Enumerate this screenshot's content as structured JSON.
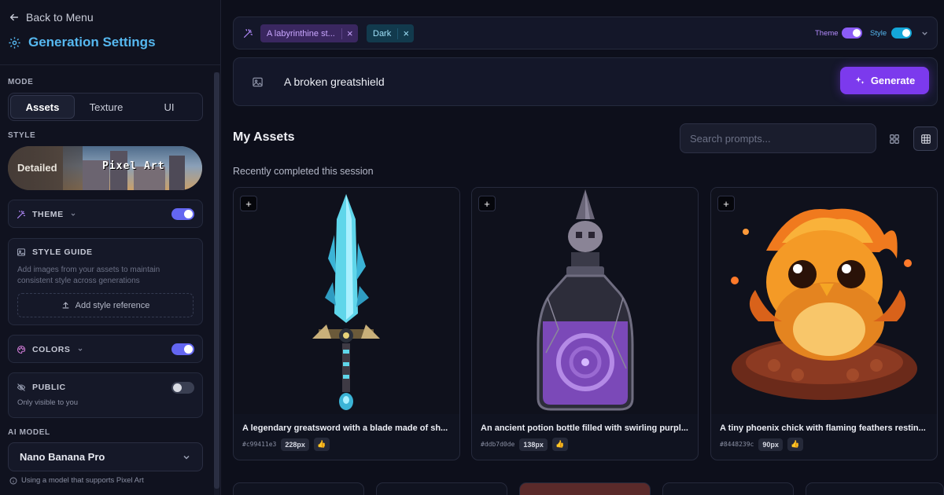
{
  "sidebar": {
    "back_label": "Back to Menu",
    "title": "Generation Settings",
    "mode": {
      "label": "MODE",
      "options": [
        "Assets",
        "Texture",
        "UI"
      ],
      "selected": "Assets"
    },
    "style": {
      "label": "STYLE",
      "left_option": "Detailed",
      "right_option": "Pixel Art"
    },
    "theme": {
      "label": "THEME",
      "enabled": true
    },
    "style_guide": {
      "label": "STYLE GUIDE",
      "description": "Add images from your assets to maintain consistent style across generations",
      "add_button": "Add style reference"
    },
    "colors": {
      "label": "COLORS",
      "enabled": true
    },
    "public": {
      "label": "PUBLIC",
      "enabled": false,
      "subtitle": "Only visible to you"
    },
    "ai_model": {
      "label": "AI MODEL",
      "selected": "Nano Banana Pro",
      "note": "Using a model that supports Pixel Art"
    }
  },
  "topbar": {
    "chips": [
      {
        "label": "A labyrinthine st...",
        "kind": "theme"
      },
      {
        "label": "Dark",
        "kind": "style"
      }
    ],
    "theme_toggle_label": "Theme",
    "style_toggle_label": "Style",
    "theme_toggle_on": true,
    "style_toggle_on": true
  },
  "prompt": {
    "value": "A broken greatshield",
    "generate_label": "Generate"
  },
  "assets": {
    "title": "My Assets",
    "search_placeholder": "Search prompts...",
    "recent_label": "Recently completed this session",
    "cards": [
      {
        "caption": "A legendary greatsword with a blade made of sh...",
        "hash": "#c99411e3",
        "size": "228px",
        "icon": "thumbs-up-icon"
      },
      {
        "caption": "An ancient potion bottle filled with swirling purpl...",
        "hash": "#ddb7d0de",
        "size": "138px",
        "icon": "thumbs-up-icon"
      },
      {
        "caption": "A tiny phoenix chick with flaming feathers restin...",
        "hash": "#8448239c",
        "size": "90px",
        "icon": "thumbs-up-icon"
      }
    ]
  },
  "colors": {
    "accent_blue": "#56b8f0",
    "generate_purple": "#7c3aed",
    "toggle_indigo": "#6366f1",
    "theme_chip": "#3a2760",
    "dark_chip": "#123a4d"
  }
}
